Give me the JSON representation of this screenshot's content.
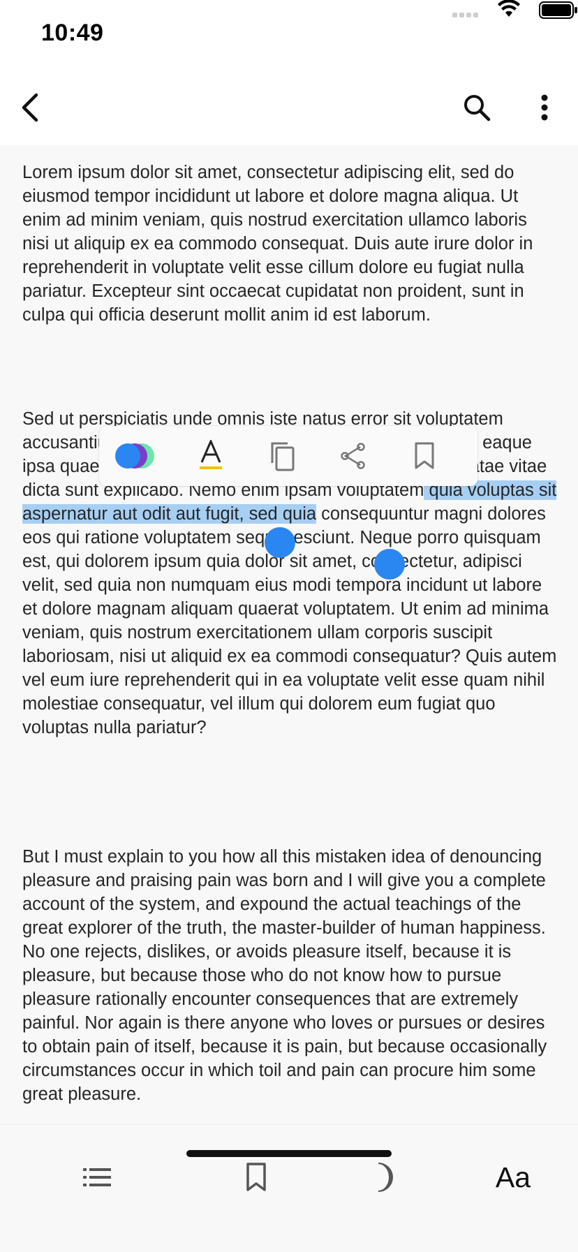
{
  "status": {
    "time": "10:49"
  },
  "nav": {
    "back_icon": "chevron-left-icon",
    "search_icon": "search-icon",
    "more_icon": "more-vertical-icon"
  },
  "content": {
    "p1": "Lorem ipsum dolor sit amet, consectetur adipiscing elit, sed do eiusmod tempor incididunt ut labore et dolore magna aliqua. Ut enim ad minim veniam, quis nostrud exercitation ullamco laboris nisi ut aliquip ex ea commodo consequat. Duis aute irure dolor in reprehenderit in voluptate velit esse cillum dolore eu fugiat nulla pariatur. Excepteur sint occaecat cupidatat non proident, sunt in culpa qui officia deserunt mollit anim id est laborum.",
    "p2_before": "Sed ut perspiciatis unde omnis iste natus error sit voluptatem accusantium doloremque laudantium, totam rem aperiam, eaque ipsa quae ab illo inventore veritatis et quasi architecto beatae vitae dicta sunt explicabo. Nemo enim ipsam voluptatem",
    "p2_selected": " quia voluptas sit aspernatur aut odit aut fugit, sed quia",
    "p2_after": " consequuntur magni dolores eos qui ratione voluptatem sequi nesciunt. Neque porro quisquam est, qui dolorem ipsum quia dolor sit amet, consectetur, adipisci velit, sed quia non numquam eius modi tempora incidunt ut labore et dolore magnam aliquam quaerat voluptatem. Ut enim ad minima veniam, quis nostrum exercitationem ullam corporis suscipit laboriosam, nisi ut aliquid ex ea commodi consequatur? Quis autem vel eum iure reprehenderit qui in ea voluptate velit esse quam nihil molestiae consequatur, vel illum qui dolorem eum fugiat quo voluptas nulla pariatur?",
    "p3": "But I must explain to you how all this mistaken idea of denouncing pleasure and praising pain was born and I will give you a complete account of the system, and expound the actual teachings of the great explorer of the truth, the master-builder of human happiness. No one rejects, dislikes, or avoids pleasure itself, because it is pleasure, but because those who do not know how to pursue pleasure rationally encounter consequences that are extremely painful. Nor again is there anyone who loves or pursues or desires to obtain pain of itself, because it is pain, but because occasionally circumstances occur in which toil and pain can procure him some great pleasure."
  },
  "selection_toolbar": {
    "highlight_colors": [
      "#2a86f0",
      "#7b3fc4",
      "#6ee6a8"
    ],
    "items": [
      "highlight-color-icon",
      "text-underline-icon",
      "copy-icon",
      "share-icon",
      "bookmark-icon"
    ],
    "underline_color": "#f2c200"
  },
  "colors": {
    "selection": "#a7cff3",
    "handle": "#2a86f0"
  },
  "bottom_bar": {
    "font_label": "Aa",
    "items": [
      "toc-list-icon",
      "bookmark-icon",
      "night-mode-moon-icon",
      "font-settings"
    ]
  }
}
